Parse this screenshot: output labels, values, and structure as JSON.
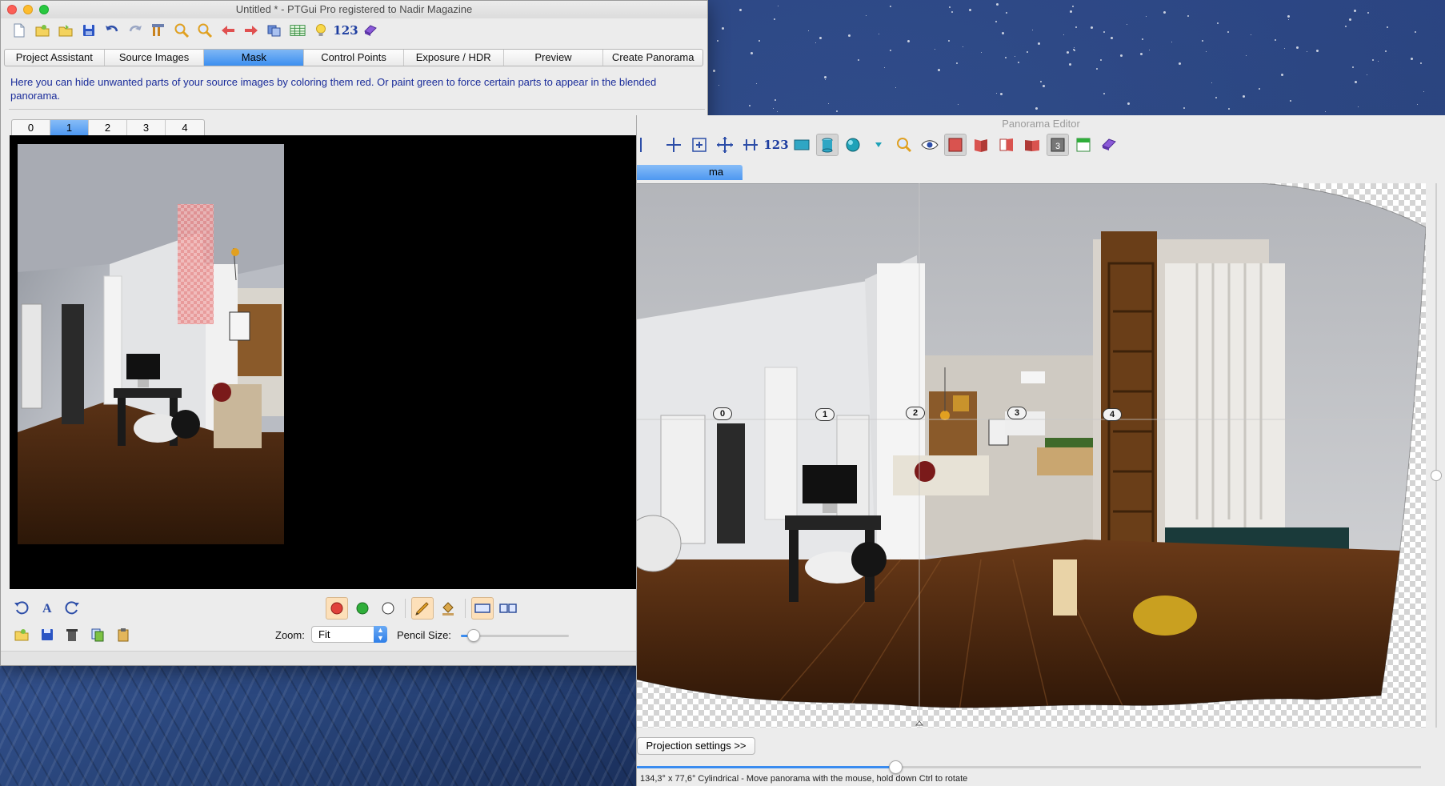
{
  "main_window": {
    "title": "Untitled * - PTGui Pro registered to Nadir Magazine",
    "toolbar": [
      {
        "name": "new-document-icon"
      },
      {
        "name": "open-folder-icon"
      },
      {
        "name": "open-recent-icon"
      },
      {
        "name": "save-icon"
      },
      {
        "name": "undo-icon"
      },
      {
        "name": "redo-icon"
      },
      {
        "name": "tools-icon"
      },
      {
        "name": "zoom-in-icon"
      },
      {
        "name": "zoom-out-icon"
      },
      {
        "name": "arrow-left-icon"
      },
      {
        "name": "arrow-right-icon"
      },
      {
        "name": "layers-icon"
      },
      {
        "name": "table-icon"
      },
      {
        "name": "lightbulb-icon"
      },
      {
        "name": "numbers-icon",
        "text": "123"
      },
      {
        "name": "batch-icon"
      }
    ],
    "tabs": [
      "Project Assistant",
      "Source Images",
      "Mask",
      "Control Points",
      "Exposure / HDR",
      "Preview",
      "Create Panorama"
    ],
    "active_tab": "Mask",
    "help_text": "Here you can hide unwanted parts of your source images by coloring them red. Or paint green to force certain parts to appear in the blended panorama.",
    "image_tabs": [
      "0",
      "1",
      "2",
      "3",
      "4"
    ],
    "active_image_tab": "1",
    "zoom": {
      "label": "Zoom:",
      "value": "Fit"
    },
    "pencil": {
      "label": "Pencil Size:",
      "level": 0.12
    }
  },
  "pano_editor": {
    "title": "Panorama Editor",
    "toolbar_numbers_text": "123",
    "tab_label": "ma",
    "image_markers": [
      "0",
      "1",
      "2",
      "3",
      "4"
    ],
    "projection_button": "Projection settings >>",
    "status": "134,3° x 77,6° Cylindrical - Move panorama with the mouse, hold down Ctrl to rotate",
    "fov_level": 0.33
  },
  "colors": {
    "mask_red": "#e86a6a",
    "mask_green": "#2fae3a",
    "accent_blue": "#3a8cf0",
    "help_text_blue": "#1a2c9a"
  }
}
